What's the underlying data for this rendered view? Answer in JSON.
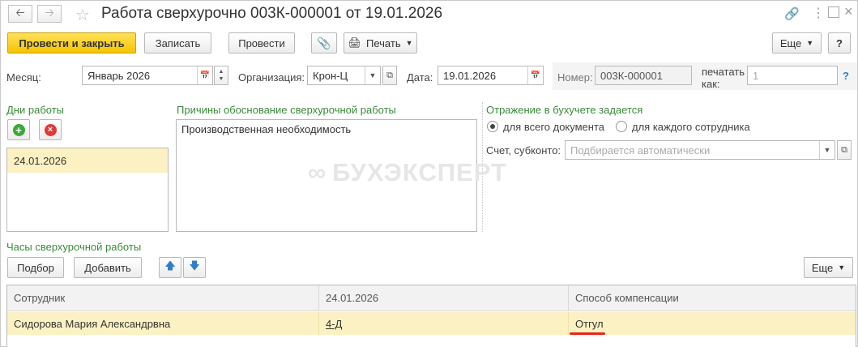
{
  "window": {
    "title": "Работа сверхурочно 003К-000001 от 19.01.2026",
    "back_icon": "arrow-left-icon",
    "forward_icon": "arrow-right-icon"
  },
  "toolbar": {
    "post_close": "Провести и закрыть",
    "save": "Записать",
    "post": "Провести",
    "print": "Печать",
    "more": "Еще",
    "help": "?"
  },
  "header": {
    "month_label": "Месяц:",
    "month_value": "Январь 2026",
    "org_label": "Организация:",
    "org_value": "Крон-Ц",
    "date_label": "Дата:",
    "date_value": "19.01.2026",
    "number_label": "Номер:",
    "number_value": "003К-000001",
    "print_as_label_1": "печатать",
    "print_as_label_2": "как:",
    "print_as_value": "1",
    "help": "?"
  },
  "work_days": {
    "title": "Дни работы",
    "items": [
      "24.01.2026"
    ]
  },
  "reasons": {
    "title": "Причины обоснование сверхурочной работы",
    "text": "Производственная необходимость"
  },
  "accounting": {
    "title": "Отражение в бухучете задается",
    "option_1": "для всего документа",
    "option_2": "для каждого сотрудника",
    "account_label": "Счет, субконто:",
    "account_placeholder": "Подбирается автоматически"
  },
  "overtime": {
    "title": "Часы сверхурочной работы",
    "pick": "Подбор",
    "add": "Добавить",
    "more": "Еще",
    "columns": [
      "Сотрудник",
      "24.01.2026",
      "Способ компенсации"
    ],
    "rows": [
      {
        "employee": "Сидорова Мария Александрвна",
        "hours": "4-Д",
        "compensation": "Отгул"
      }
    ]
  },
  "watermark": "БУХЭКСПЕРТ",
  "colors": {
    "accent_green": "#3a8a3a",
    "primary_yellow": "#f5c400",
    "selected_row": "#fcf1c2",
    "underline_red": "#e8261c"
  }
}
